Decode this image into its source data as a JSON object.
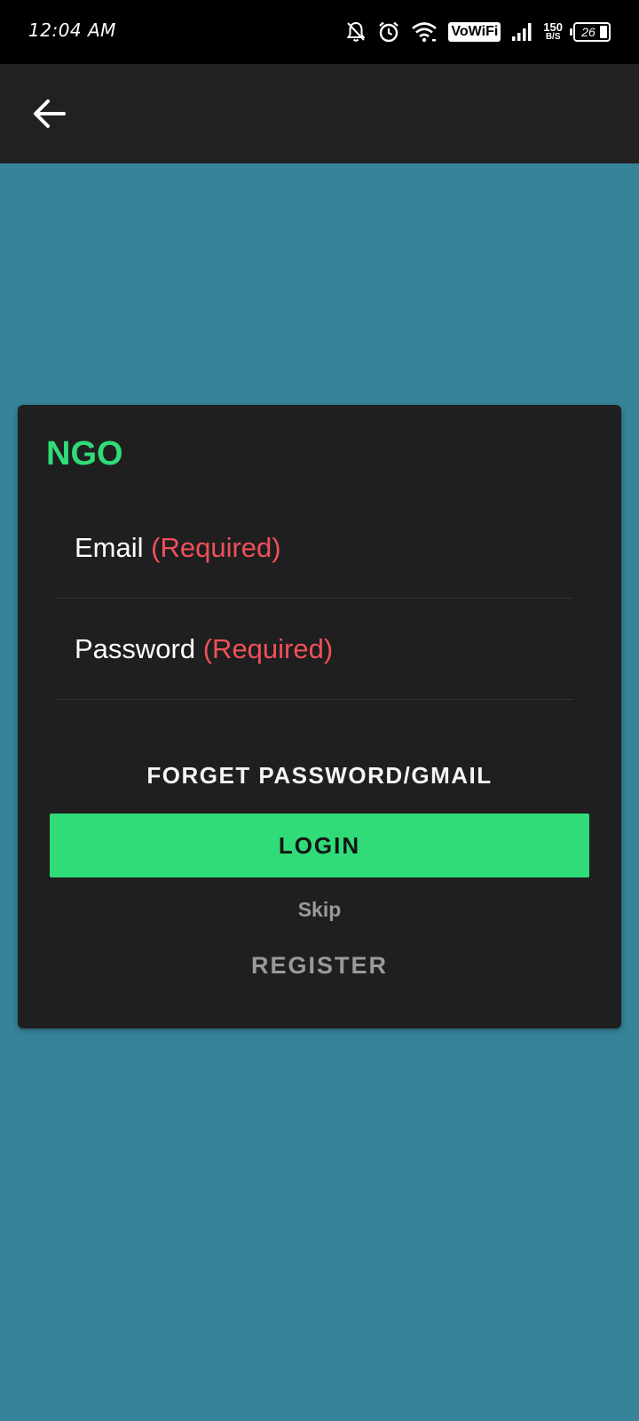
{
  "status_bar": {
    "time": "12:04 AM",
    "vowifi": "VoWiFi",
    "net_speed_value": "150",
    "net_speed_unit": "B/S",
    "battery_level": "26",
    "icons": [
      "bell-off-icon",
      "alarm-icon",
      "wifi-icon",
      "signal-icon",
      "battery-icon"
    ]
  },
  "app_bar": {
    "back_icon": "arrow-left-icon"
  },
  "login_card": {
    "title": "NGO",
    "email_label": "Email",
    "email_required": "(Required)",
    "password_label": "Password",
    "password_required": "(Required)",
    "forget_label": "FORGET PASSWORD/GMAIL",
    "login_label": "LOGIN",
    "skip_label": "Skip",
    "register_label": "REGISTER"
  },
  "colors": {
    "background": "#36839a",
    "app_bar": "#212121",
    "card": "#1f1f1f",
    "accent_green": "#2fdc78",
    "required_red": "#f0505a"
  }
}
